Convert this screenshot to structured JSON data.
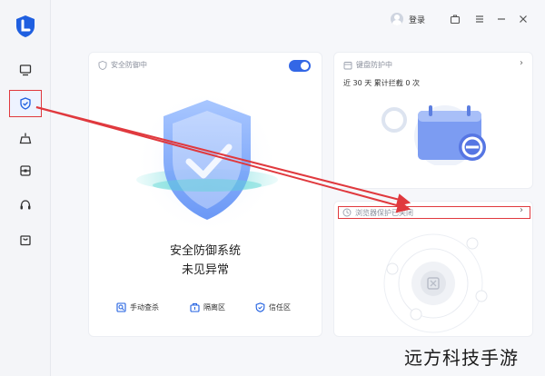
{
  "sidebar": {
    "items": [
      {
        "icon": "monitor-icon"
      },
      {
        "icon": "shield-check-icon",
        "active": true
      },
      {
        "icon": "broom-icon"
      },
      {
        "icon": "toolbox-icon"
      },
      {
        "icon": "headset-icon"
      },
      {
        "icon": "bag-icon"
      }
    ]
  },
  "topbar": {
    "login_label": "登录",
    "icons": [
      "briefcase-icon",
      "menu-icon",
      "minimize-icon",
      "close-icon"
    ]
  },
  "security_card": {
    "title": "安全防御中",
    "toggle_on": true,
    "status_line1": "安全防御系统",
    "status_line2": "未见异常",
    "actions": [
      {
        "label": "手动查杀",
        "icon": "scan-icon"
      },
      {
        "label": "隔离区",
        "icon": "quarantine-icon"
      },
      {
        "label": "信任区",
        "icon": "trust-icon"
      }
    ]
  },
  "protection_card": {
    "title": "键盘防护中",
    "summary": "近 30 天 累计拦截 0 次"
  },
  "browser_card": {
    "title": "浏览器保护已关闭"
  },
  "watermark": "远方科技手游",
  "colors": {
    "accent": "#3367e6",
    "highlight": "#e0393e"
  }
}
